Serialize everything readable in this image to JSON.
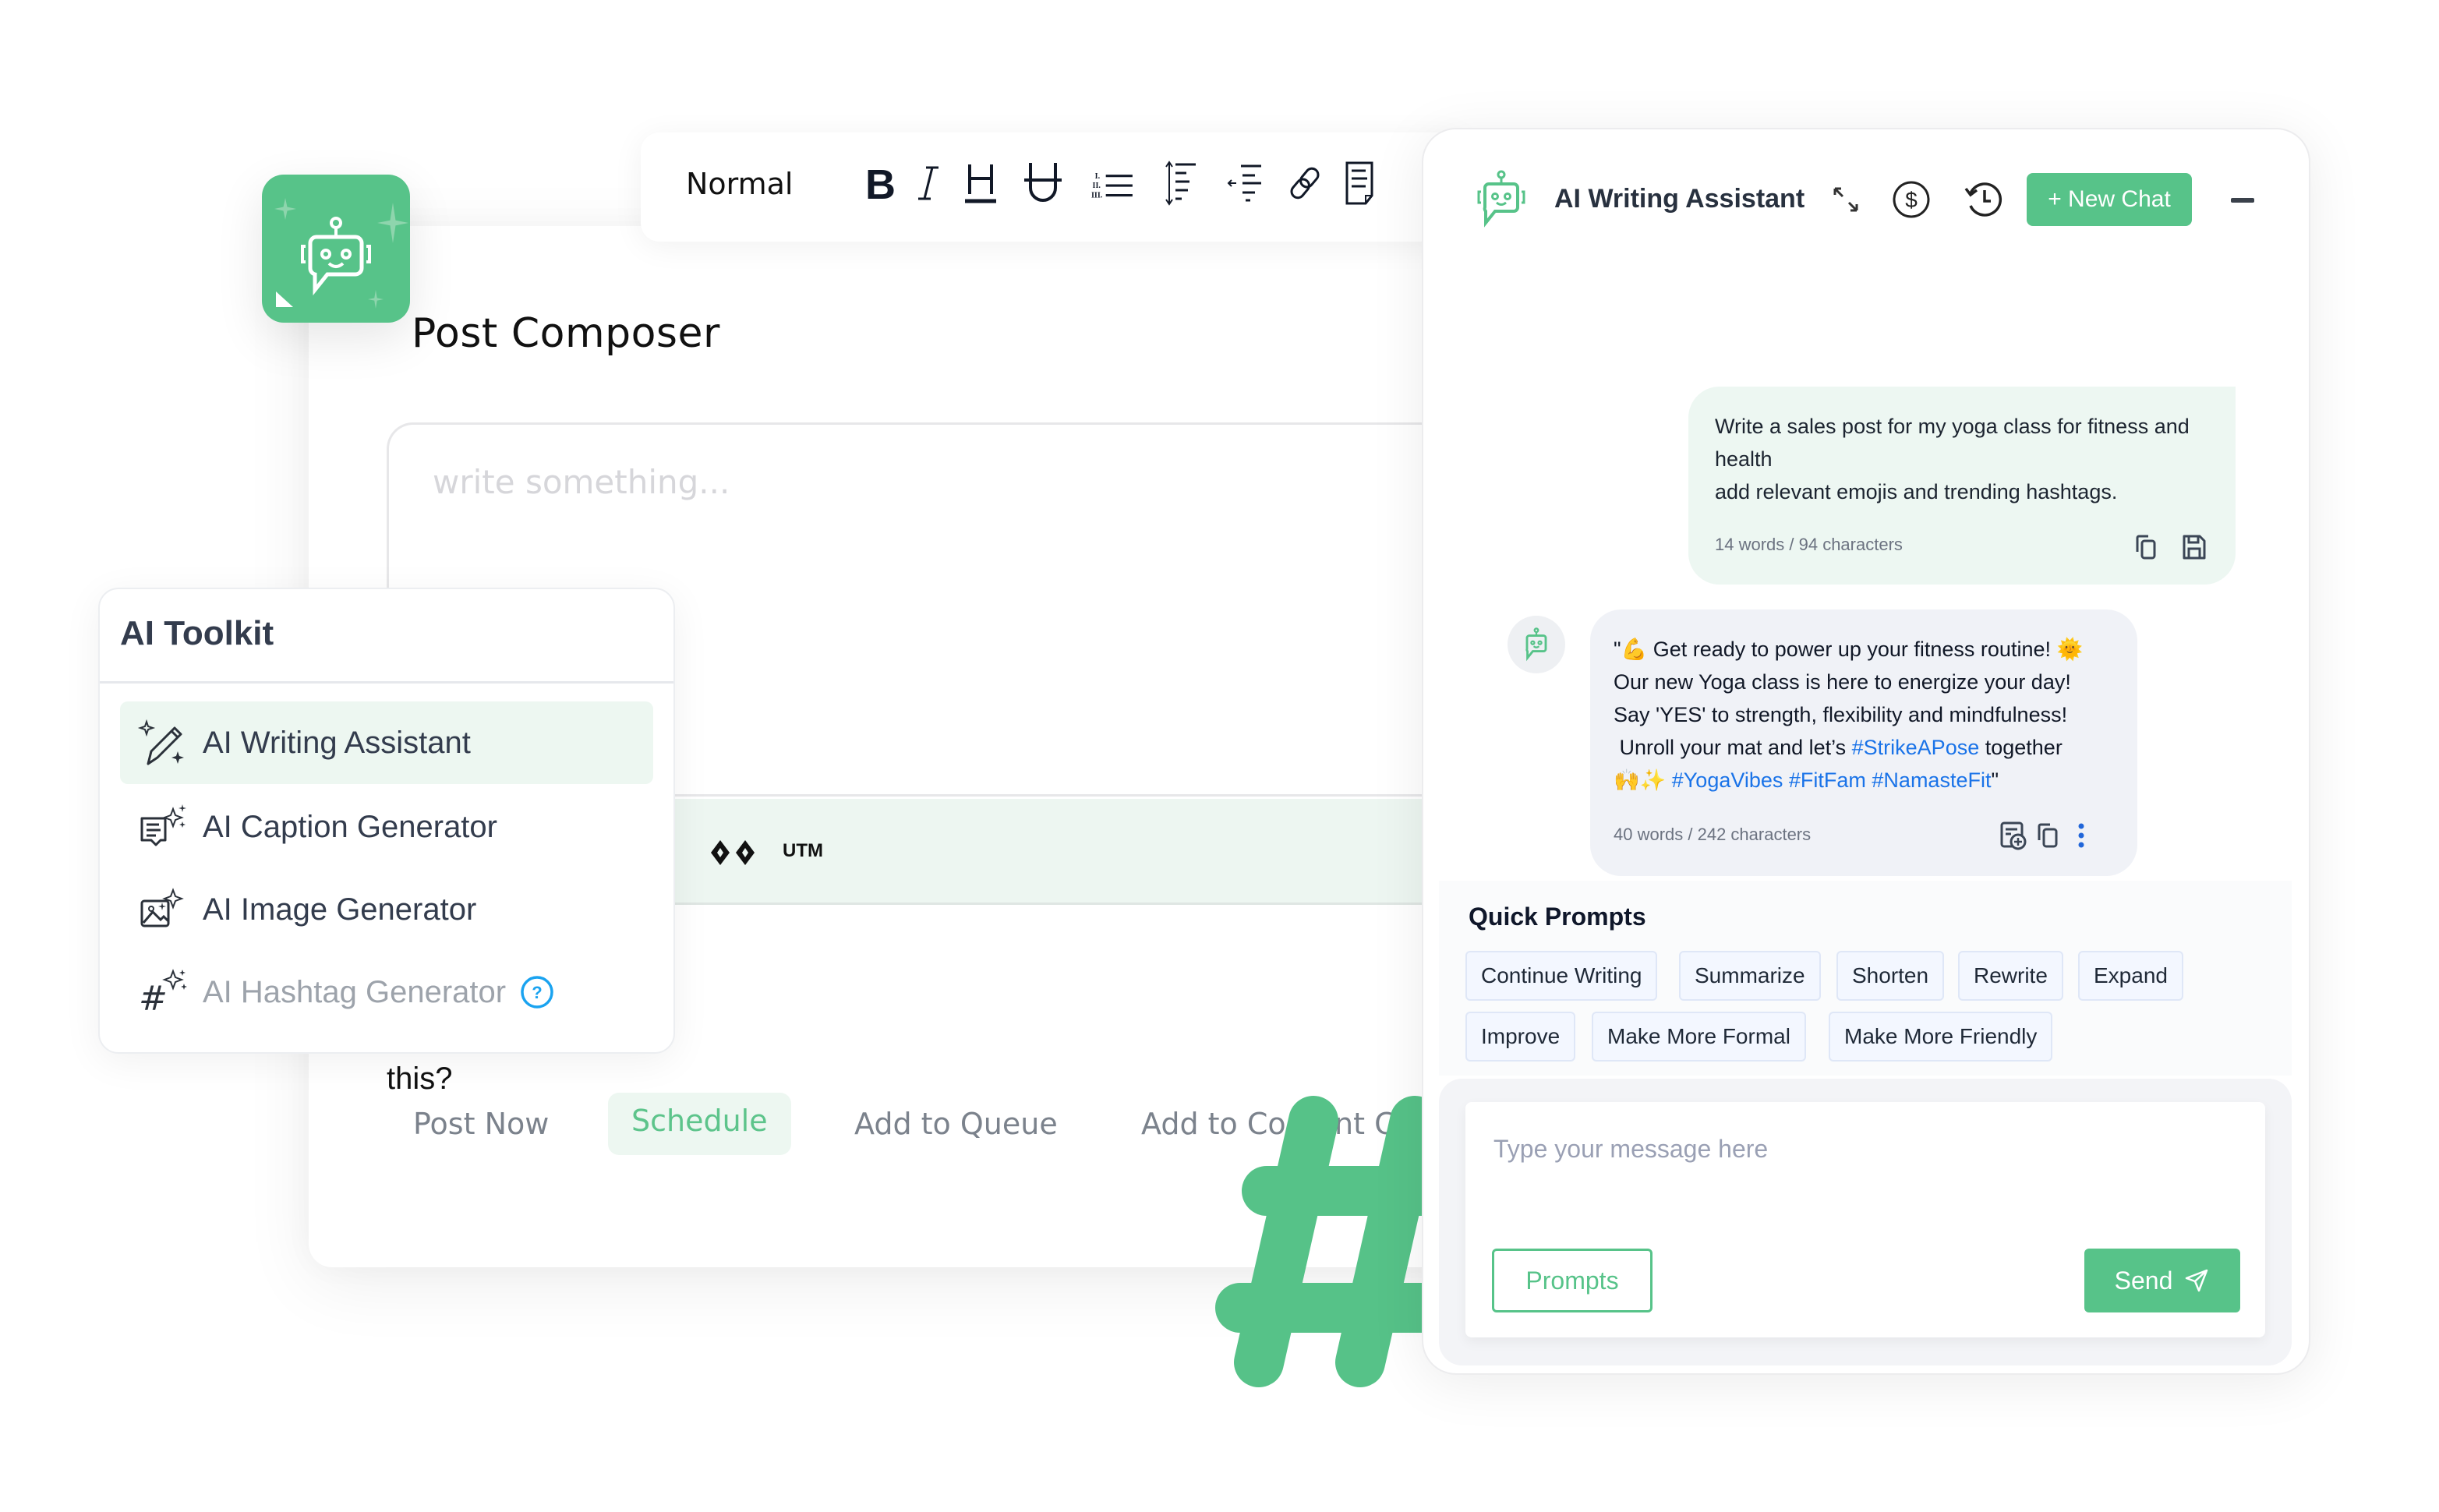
{
  "colors": {
    "brand_green": "#57c389",
    "link_blue": "#1a73e8",
    "light_green": "#edf7f1"
  },
  "composer": {
    "title": "Post Composer",
    "editor_placeholder": "write something...",
    "utm_label": "UTM",
    "question_fragment": "this?",
    "actions": [
      {
        "label": "Post Now",
        "active": false
      },
      {
        "label": "Schedule",
        "active": true
      },
      {
        "label": "Add to Queue",
        "active": false
      },
      {
        "label": "Add to Content Category",
        "active": false
      }
    ]
  },
  "toolbar": {
    "text_style": "Normal",
    "buttons": [
      "bold-icon",
      "italic-icon",
      "heading-icon",
      "underline-icon",
      "numbered-list-icon",
      "line-height-icon",
      "outdent-icon",
      "link-icon",
      "document-icon"
    ]
  },
  "toolkit": {
    "title": "AI Toolkit",
    "items": [
      {
        "label": "AI Writing Assistant",
        "icon": "magic-pencil-icon",
        "selected": true,
        "disabled": false
      },
      {
        "label": "AI Caption Generator",
        "icon": "caption-sparkle-icon",
        "selected": false,
        "disabled": false
      },
      {
        "label": "AI Image Generator",
        "icon": "image-sparkle-icon",
        "selected": false,
        "disabled": false
      },
      {
        "label": "AI Hashtag Generator",
        "icon": "hashtag-sparkle-icon",
        "selected": false,
        "disabled": true
      }
    ]
  },
  "assistant": {
    "title": "AI Writing Assistant",
    "new_chat_label": "+ New Chat",
    "header_icons": [
      "expand-icon",
      "credits-dollar-icon",
      "history-icon",
      "minimize-icon"
    ],
    "messages": [
      {
        "role": "user",
        "lines": [
          "Write a sales post for my yoga class for fitness and health",
          "add relevant emojis and trending hashtags."
        ],
        "meta": "14 words / 94 characters"
      },
      {
        "role": "assistant",
        "line1": "\"💪 Get ready to power up your fitness routine! 🌞",
        "line2": "Our new Yoga class is here to energize your day!",
        "line3": "Say 'YES' to strength, flexibility and mindfulness!",
        "line4_pre": " Unroll your mat and let’s ",
        "line4_tag": "#StrikeAPose",
        "line4_post": " together",
        "line5_emoji": "🙌✨ ",
        "line5_tags": "#YogaVibes #FitFam #NamasteFit",
        "line5_post": "\"",
        "meta": "40 words / 242 characters"
      }
    ],
    "quick_prompts": {
      "title": "Quick Prompts",
      "items": [
        "Continue Writing",
        "Summarize",
        "Shorten",
        "Rewrite",
        "Expand",
        "Improve",
        "Make More Formal",
        "Make More Friendly"
      ]
    },
    "input": {
      "placeholder": "Type your message here",
      "value": ""
    },
    "prompts_button": "Prompts",
    "send_button": "Send"
  }
}
